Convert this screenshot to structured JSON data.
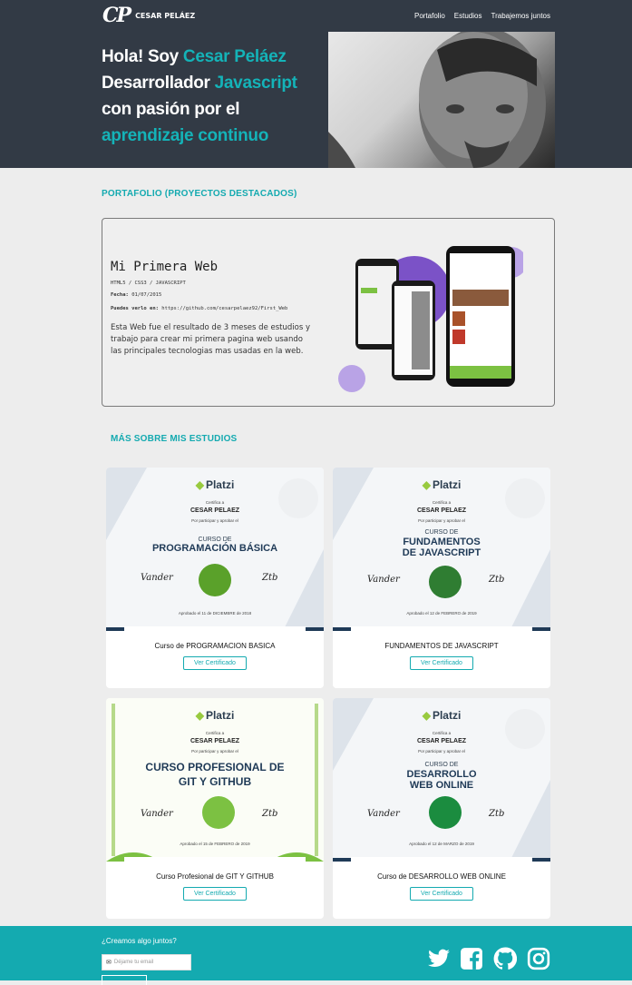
{
  "header": {
    "logo_mark": "CP",
    "logo_text": "CESAR PELÁEZ",
    "nav": [
      "Portafolio",
      "Estudios",
      "Trabajemos juntos"
    ]
  },
  "hero": {
    "p1": "Hola! Soy ",
    "name": "Cesar Peláez",
    "p2": "Desarrollador ",
    "tech": "Javascript",
    "p3": " con pasión por el ",
    "learn": "aprendizaje continuo"
  },
  "portfolio": {
    "title": "PORTAFOLIO (PROYECTOS DESTACADOS)",
    "project": {
      "name": "Mi Primera Web",
      "tags": "HTML5 / CSS3 / JAVASCRIPT",
      "date_label": "Fecha:",
      "date": "01/07/2015",
      "link_label": "Puedes verlo en:",
      "link": "https://github.com/cesarpelaez92/First_Web",
      "description": "Esta Web fue el resultado de 3 meses de estudios y trabajo para crear mi primera pagina web usando las principales tecnologias mas usadas en la web."
    }
  },
  "studies": {
    "title": "MÁS SOBRE MIS ESTUDIOS",
    "certs": [
      {
        "title": "Curso de PROGRAMACION BASICA",
        "button": "Ver Certificado",
        "course_l1": "CURSO DE",
        "course_l2": "PROGRAMACIÓN BÁSICA",
        "approved": "Aprobado el 11 de DICIEMBRE de 2018",
        "badge_color": "#5aa12a"
      },
      {
        "title": "FUNDAMENTOS DE JAVASCRIPT",
        "button": "Ver Certificado",
        "course_l1": "CURSO DE",
        "course_l2": "FUNDAMENTOS",
        "course_l3": "DE JAVASCRIPT",
        "approved": "Aprobado el 12 de FEBRERO de 2019",
        "badge_color": "#2f7d32"
      },
      {
        "title": "Curso Profesional de GIT Y GITHUB",
        "button": "Ver Certificado",
        "course_l1": "CURSO PROFESIONAL DE",
        "course_l2": "GIT Y GITHUB",
        "approved": "Aprobado el 15 de FEBRERO de 2019",
        "badge_color": "#7cc142"
      },
      {
        "title": "Curso de DESARROLLO WEB ONLINE",
        "button": "Ver Certificado",
        "course_l1": "CURSO DE",
        "course_l2": "DESARROLLO",
        "course_l3": "WEB ONLINE",
        "approved": "Aprobado el 12 de MARZO de 2019",
        "badge_color": "#1b8c3f"
      }
    ],
    "cert_common": {
      "brand": "Platzi",
      "certifica": "Certifica a",
      "student": "CESAR PELAEZ",
      "por": "Por participar y aprobar el"
    }
  },
  "footer": {
    "question": "¿Creamos algo juntos?",
    "email_placeholder": "Déjame tu email",
    "social": [
      "twitter-icon",
      "facebook-icon",
      "github-icon",
      "instagram-icon"
    ]
  },
  "colors": {
    "accent": "#14aab0",
    "hero_bg": "#323a45",
    "page_bg": "#ededed"
  }
}
